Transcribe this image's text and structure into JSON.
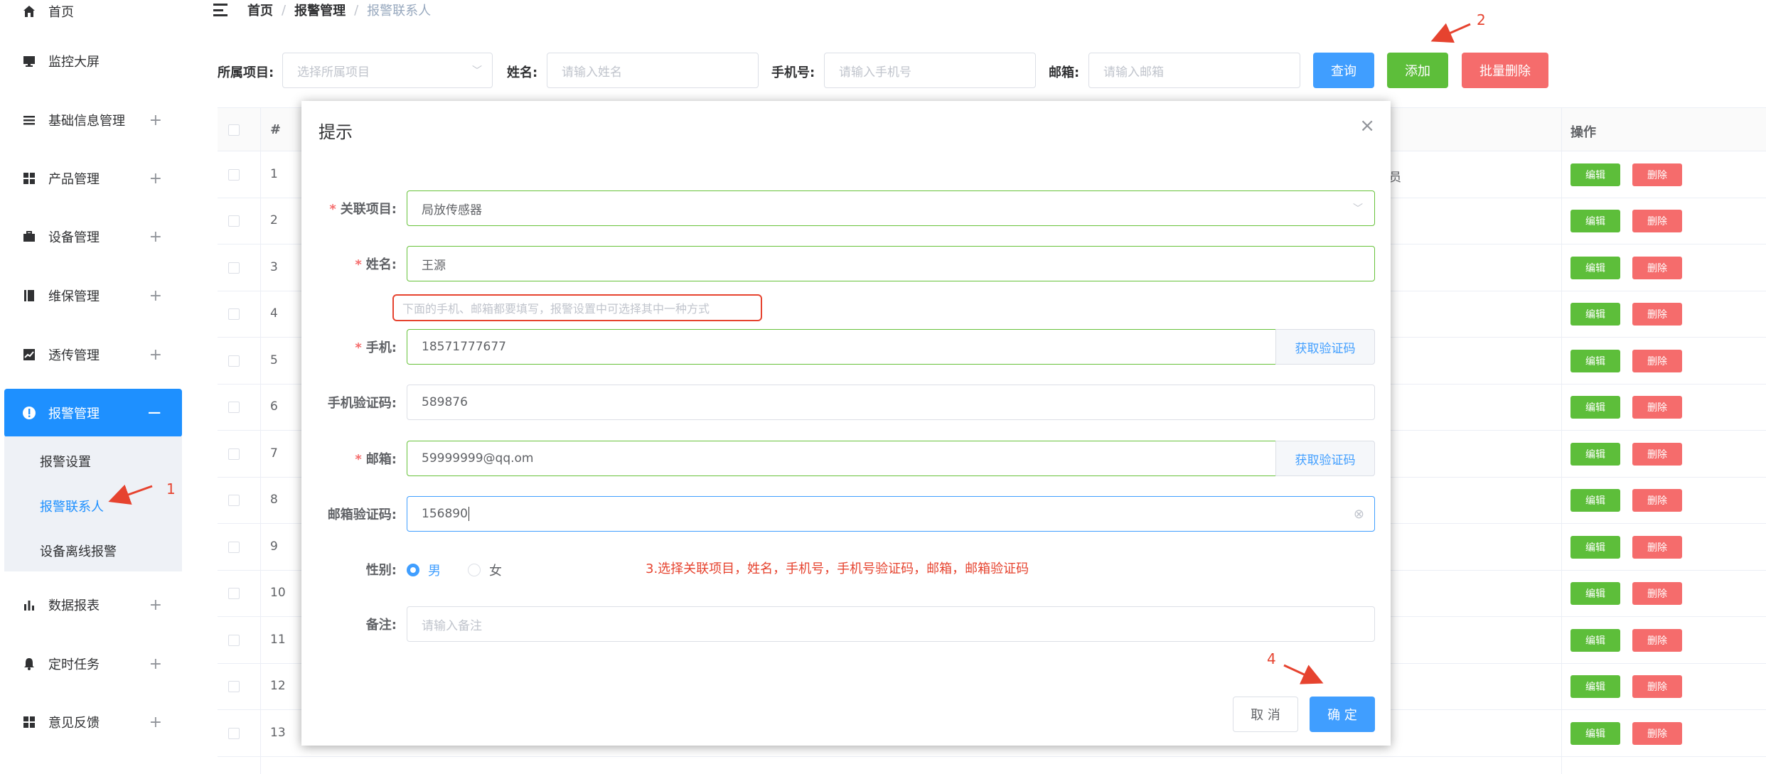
{
  "colors": {
    "primary": "#409eff",
    "success": "#5dbe3a",
    "danger": "#f56c6c",
    "annotation": "#e6432f",
    "sidebar_active": "#1e90ff"
  },
  "sidebar": {
    "items": [
      {
        "label": "首页",
        "icon": "home-icon"
      },
      {
        "label": "监控大屏",
        "icon": "monitor-icon"
      },
      {
        "label": "基础信息管理",
        "icon": "list-icon"
      },
      {
        "label": "产品管理",
        "icon": "grid-icon"
      },
      {
        "label": "设备管理",
        "icon": "briefcase-icon"
      },
      {
        "label": "维保管理",
        "icon": "book-icon"
      },
      {
        "label": "透传管理",
        "icon": "chart-line-icon"
      },
      {
        "label": "报警管理",
        "icon": "alert-icon"
      },
      {
        "label": "数据报表",
        "icon": "bar-chart-icon"
      },
      {
        "label": "定时任务",
        "icon": "bell-icon"
      },
      {
        "label": "意见反馈",
        "icon": "grid-icon"
      }
    ],
    "submenu": [
      "报警设置",
      "报警联系人",
      "设备离线报警"
    ]
  },
  "breadcrumb": {
    "home": "首页",
    "section": "报警管理",
    "current": "报警联系人",
    "sep": "/"
  },
  "search": {
    "project_label": "所属项目:",
    "project_placeholder": "选择所属项目",
    "name_label": "姓名:",
    "name_placeholder": "请输入姓名",
    "phone_label": "手机号:",
    "phone_placeholder": "请输入手机号",
    "email_label": "邮箱:",
    "email_placeholder": "请输入邮箱",
    "query": "查询",
    "add": "添加",
    "batch_delete": "批量删除"
  },
  "table": {
    "headers": {
      "index": "#",
      "ops": "操作"
    },
    "rows": [
      "1",
      "2",
      "3",
      "4",
      "5",
      "6",
      "7",
      "8",
      "9",
      "10",
      "11",
      "12",
      "13"
    ],
    "row1_fragment": "员",
    "edit": "编辑",
    "delete": "删除"
  },
  "dialog": {
    "title": "提示",
    "close": "×",
    "project_label": "关联项目:",
    "project_value": "局放传感器",
    "name_label": "姓名:",
    "name_value": "王源",
    "hint": "下面的手机、邮箱都要填写，报警设置中可选择其中一种方式",
    "phone_label": "手机:",
    "phone_value": "18571777677",
    "get_code": "获取验证码",
    "phone_code_label": "手机验证码:",
    "phone_code_value": "589876",
    "email_label": "邮箱:",
    "email_value": "59999999@qq.om",
    "email_code_label": "邮箱验证码:",
    "email_code_value": "156890",
    "gender_label": "性别:",
    "gender_male": "男",
    "gender_female": "女",
    "remark_label": "备注:",
    "remark_placeholder": "请输入备注",
    "cancel": "取 消",
    "ok": "确 定",
    "required_mark": "*"
  },
  "annotations": {
    "n1": "1",
    "n2": "2",
    "n4": "4",
    "step3": "3.选择关联项目，姓名，手机号，手机号验证码，邮箱，邮箱验证码"
  }
}
